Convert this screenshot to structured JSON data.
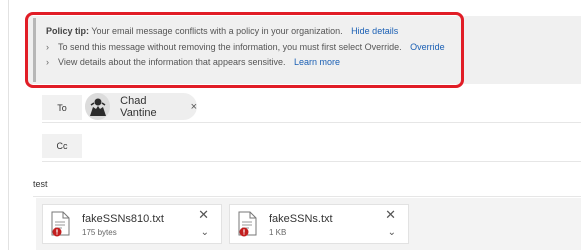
{
  "policy_tip": {
    "label": "Policy tip:",
    "message": " Your email message conflicts with a policy in your organization.",
    "hide_link": "Hide details",
    "item1_text": "To send this message without removing the information, you must first select Override.",
    "item1_link": "Override",
    "item2_text": "View details about the information that appears sensitive.",
    "item2_link": "Learn more",
    "chevron_glyph": "›",
    "highlight_color": "#e11d26"
  },
  "recipients": {
    "to_label": "To",
    "to_name": "Chad Vantine",
    "remove_glyph": "×",
    "cc_label": "Cc"
  },
  "subject": "test",
  "attachments": [
    {
      "name": "fakeSSNs810.txt",
      "size": "175 bytes",
      "icon": "text-file-warning-icon"
    },
    {
      "name": "fakeSSNs.txt",
      "size": "1 KB",
      "icon": "text-file-warning-icon"
    }
  ],
  "glyphs": {
    "close": "✕",
    "chevron_down": "⌄"
  },
  "colors": {
    "link": "#1a5fb4",
    "warning_badge": "#c21e1e"
  }
}
